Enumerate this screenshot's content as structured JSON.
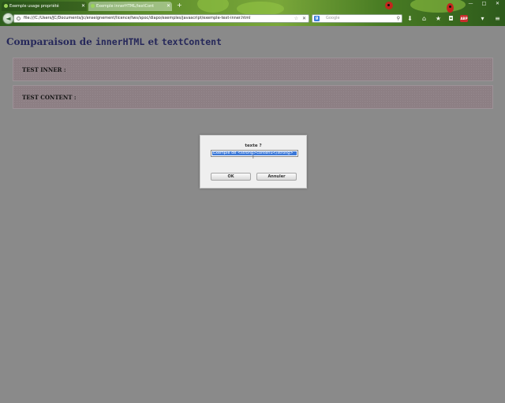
{
  "browser": {
    "tabs": [
      {
        "label": "Exemple usage propriété",
        "active": false
      },
      {
        "label": "Exemple innerHTML/textCont",
        "active": true
      }
    ],
    "new_tab": "+",
    "close_glyph": "✕",
    "window_controls": {
      "minimize": "—",
      "maximize": "□",
      "close": "✕"
    },
    "back_glyph": "◄",
    "url": "file:///C:/Users/JC/Documents/jc/enseignement/licence/tws/spoc/diapo/exemples/javascript/exemple-text-inner.html",
    "search_engine": "Google",
    "search_placeholder": "Google",
    "toolbar_icons": [
      "download-icon",
      "home-icon",
      "bookmark-star-icon",
      "lock-icon",
      "addon-icon",
      "menu-icon"
    ],
    "abp_label": "ABP"
  },
  "page": {
    "title_part1": "Comparaison de ",
    "title_code1": "innerHTML",
    "title_part2": " et ",
    "title_code2": "textContent",
    "box_inner_label": "TEST INNER :",
    "box_content_label": "TEST CONTENT :"
  },
  "dialog": {
    "message": "texte ?",
    "input_value": "Exemple de <strong>contenu</strong>",
    "ok_label": "OK",
    "cancel_label": "Annuler"
  },
  "colors": {
    "page_background": "#8a8a8a",
    "title": "#26285a",
    "box_background": "#8d7f84",
    "selection": "#3b78d8"
  }
}
